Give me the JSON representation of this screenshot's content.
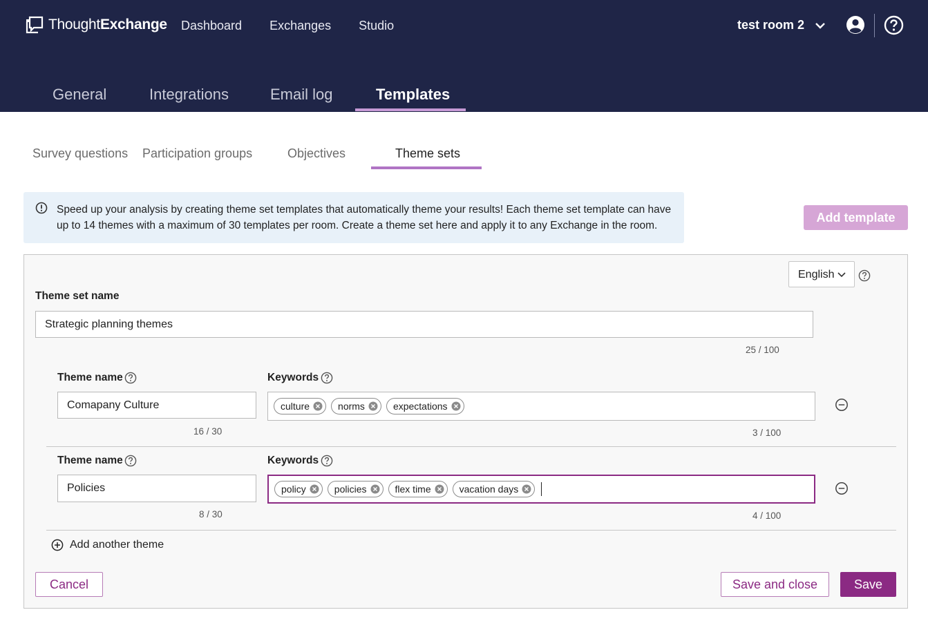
{
  "header": {
    "logo_light": "Thought",
    "logo_bold": "Exchange",
    "nav": [
      "Dashboard",
      "Exchanges",
      "Studio"
    ],
    "room_name": "test room 2"
  },
  "main_tabs": [
    "General",
    "Integrations",
    "Email log",
    "Templates"
  ],
  "active_main_tab": "Templates",
  "sub_tabs": [
    "Survey questions",
    "Participation groups",
    "Objectives",
    "Theme sets"
  ],
  "active_sub_tab": "Theme sets",
  "info_text": "Speed up your analysis by creating theme set templates that automatically theme your results! Each theme set template can have up to 14 themes with a maximum of 30 templates per room. Create a theme set here and apply it to any Exchange in the room.",
  "add_template_label": "Add template",
  "form": {
    "language": "English",
    "theme_set_label": "Theme set name",
    "theme_set_value": "Strategic planning themes",
    "theme_set_counter": "25 / 100",
    "themes": [
      {
        "name_label": "Theme name",
        "name_value": "Comapany Culture",
        "name_counter": "16 / 30",
        "keywords_label": "Keywords",
        "keywords": [
          "culture",
          "norms",
          "expectations"
        ],
        "keywords_counter": "3 / 100"
      },
      {
        "name_label": "Theme name",
        "name_value": "Policies",
        "name_counter": "8 / 30",
        "keywords_label": "Keywords",
        "keywords": [
          "policy",
          "policies",
          "flex time",
          "vacation days"
        ],
        "keywords_counter": "4 / 100"
      }
    ],
    "add_another_label": "Add another theme",
    "cancel_label": "Cancel",
    "save_close_label": "Save and close",
    "save_label": "Save"
  },
  "colors": {
    "header_bg": "#1f2547",
    "accent": "#8b2a83",
    "tab_underline": "#b074c4",
    "info_bg": "#e8f1f9",
    "add_template_bg": "#d6a6d6"
  }
}
